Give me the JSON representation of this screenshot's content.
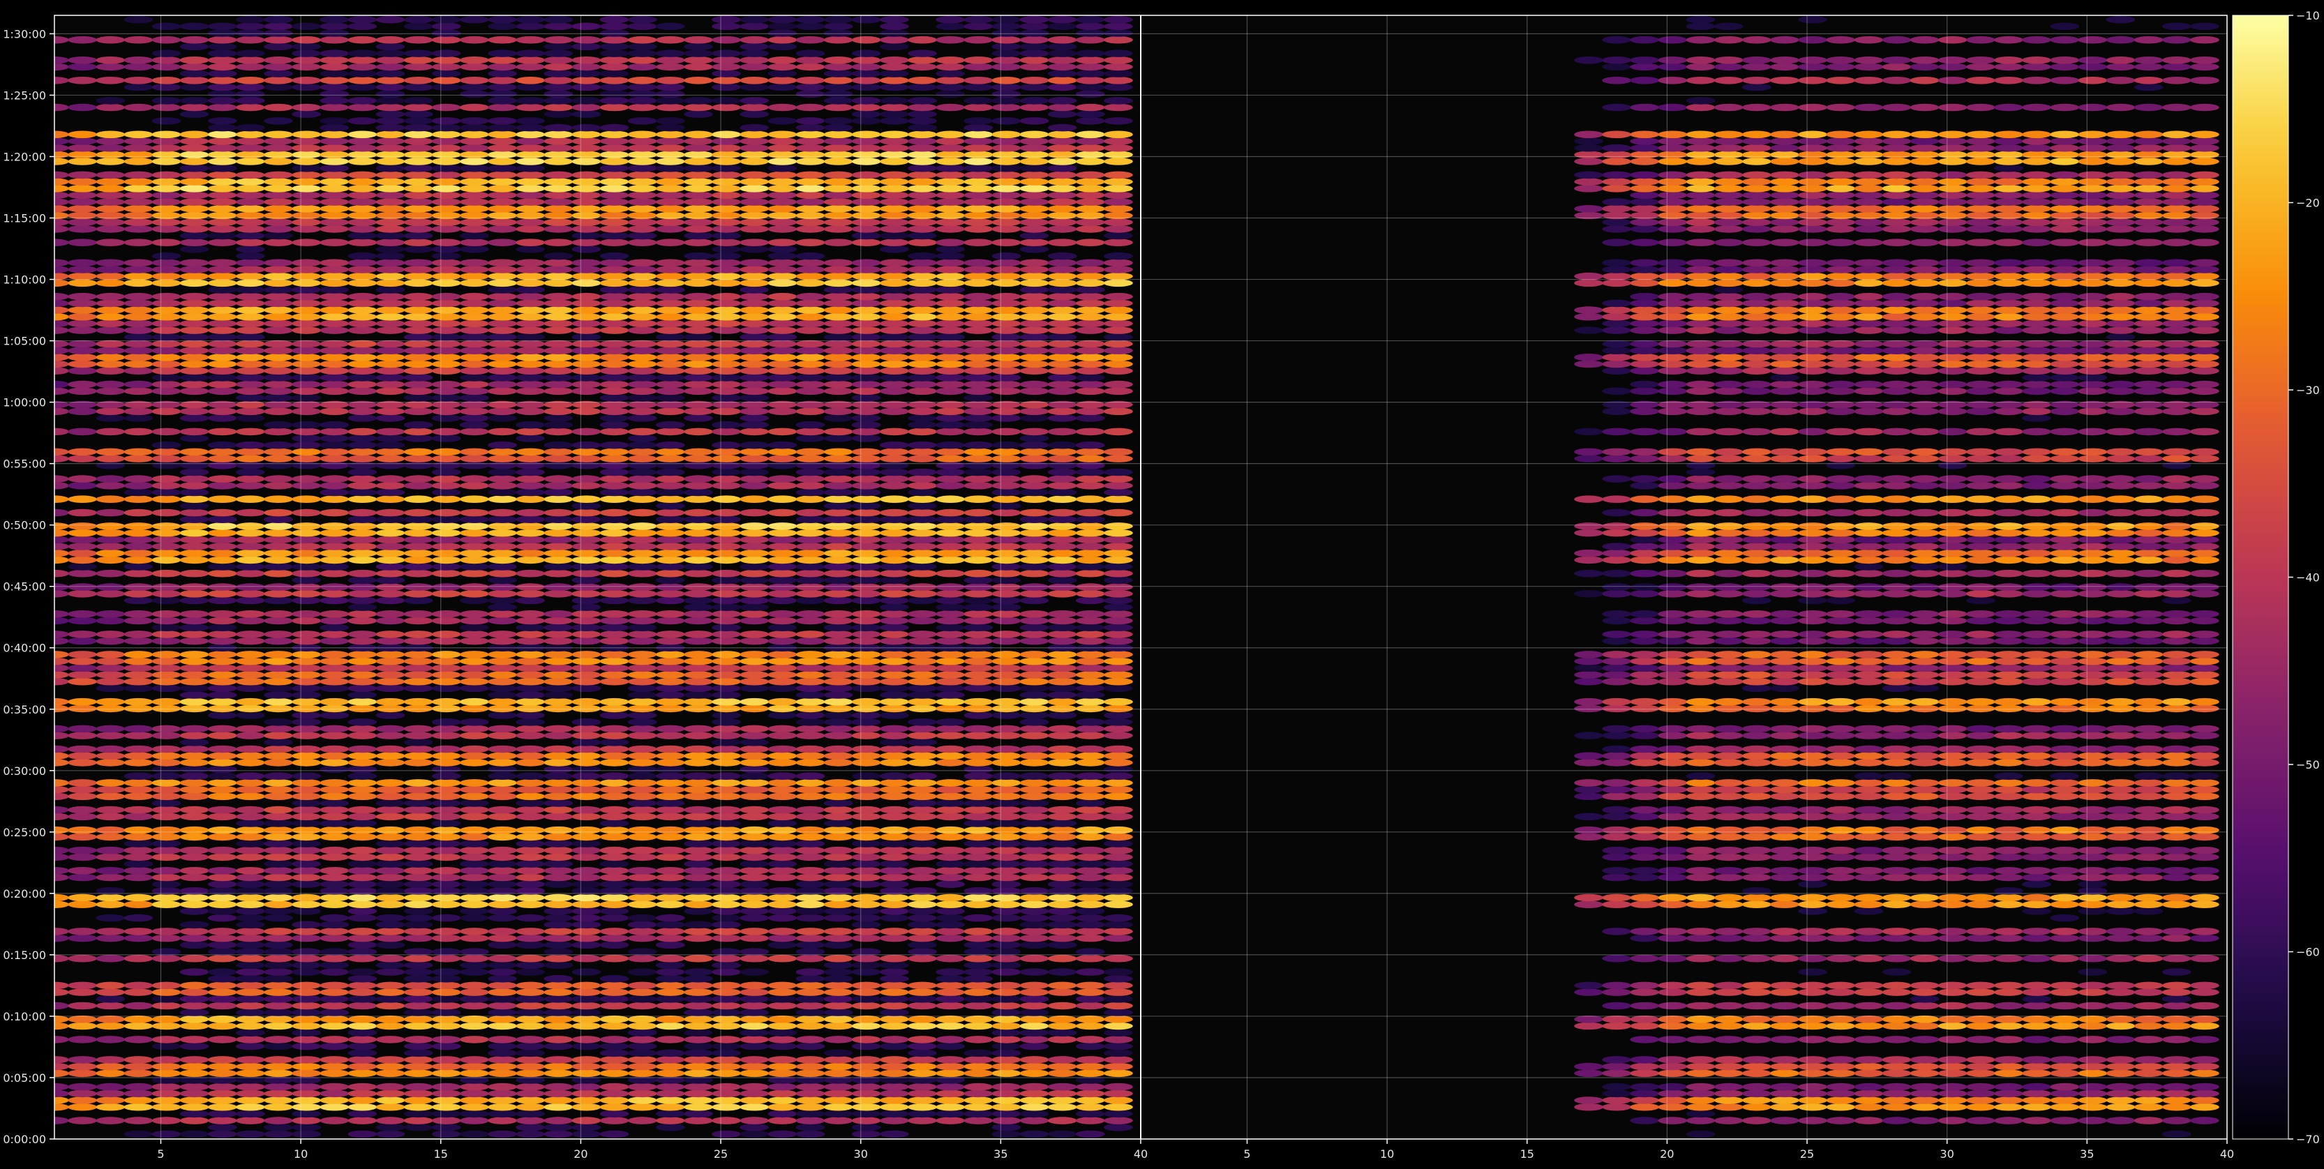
{
  "chart_data": {
    "type": "heatmap",
    "title": "",
    "panels": 2,
    "y_axis": {
      "tick_labels": [
        "0:00:00",
        "0:05:00",
        "0:10:00",
        "0:15:00",
        "0:20:00",
        "0:25:00",
        "0:30:00",
        "0:35:00",
        "0:40:00",
        "0:45:00",
        "0:50:00",
        "0:55:00",
        "1:00:00",
        "1:05:00",
        "1:10:00",
        "1:15:00",
        "1:20:00",
        "1:25:00",
        "1:30:00"
      ],
      "tick_seconds": [
        0,
        300,
        600,
        900,
        1200,
        1500,
        1800,
        2100,
        2400,
        2700,
        3000,
        3300,
        3600,
        3900,
        4200,
        4500,
        4800,
        5100,
        5400
      ],
      "range_seconds": [
        0,
        5490
      ]
    },
    "x_axis": {
      "left_panel_ticks": [
        "5",
        "10",
        "15",
        "20",
        "25",
        "30",
        "35",
        "40"
      ],
      "right_panel_ticks": [
        "5",
        "10",
        "15",
        "20",
        "25",
        "30",
        "35",
        "40"
      ],
      "tick_values": [
        5,
        10,
        15,
        20,
        25,
        30,
        35,
        40
      ],
      "range": [
        1.2,
        40
      ],
      "columns": 39
    },
    "colorbar": {
      "colormap": "inferno",
      "range": [
        -70,
        -10
      ],
      "tick_labels": [
        "−70",
        "−60",
        "−50",
        "−40",
        "−30",
        "−20",
        "−10"
      ],
      "tick_values": [
        -70,
        -60,
        -50,
        -40,
        -30,
        -20,
        -10
      ]
    },
    "grid": true,
    "strong_bands_minutes": [
      {
        "t": 2.8,
        "level": -17
      },
      {
        "t": 5.4,
        "level": -24
      },
      {
        "t": 9.3,
        "level": -18
      },
      {
        "t": 12.1,
        "level": -30
      },
      {
        "t": 19.5,
        "level": -16
      },
      {
        "t": 25.0,
        "level": -22
      },
      {
        "t": 28.0,
        "level": -28
      },
      {
        "t": 29.0,
        "level": -24
      },
      {
        "t": 30.8,
        "level": -24
      },
      {
        "t": 35.5,
        "level": -18
      },
      {
        "t": 37.5,
        "level": -28
      },
      {
        "t": 39.2,
        "level": -24
      },
      {
        "t": 47.2,
        "level": -20
      },
      {
        "t": 49.8,
        "level": -17
      },
      {
        "t": 52.1,
        "level": -20
      },
      {
        "t": 55.8,
        "level": -28
      },
      {
        "t": 63.5,
        "level": -24
      },
      {
        "t": 67.2,
        "level": -19
      },
      {
        "t": 69.8,
        "level": -18
      },
      {
        "t": 75.5,
        "level": -22
      },
      {
        "t": 77.5,
        "level": -16
      },
      {
        "t": 79.8,
        "level": -15
      },
      {
        "t": 81.8,
        "level": -17
      }
    ],
    "right_panel_onset_column": 17,
    "mid_bands_minutes": [
      1.5,
      3.8,
      6.5,
      8.0,
      10.8,
      14.8,
      16.8,
      21.5,
      23.2,
      26.5,
      31.8,
      33.0,
      38.2,
      40.8,
      42.5,
      44.5,
      46.0,
      48.5,
      51.0,
      53.5,
      57.5,
      59.5,
      61.0,
      62.5,
      64.5,
      66.2,
      68.2,
      71.0,
      73.0,
      74.5,
      76.5,
      78.5,
      80.8,
      84.0,
      86.2,
      87.5,
      89.5
    ]
  }
}
